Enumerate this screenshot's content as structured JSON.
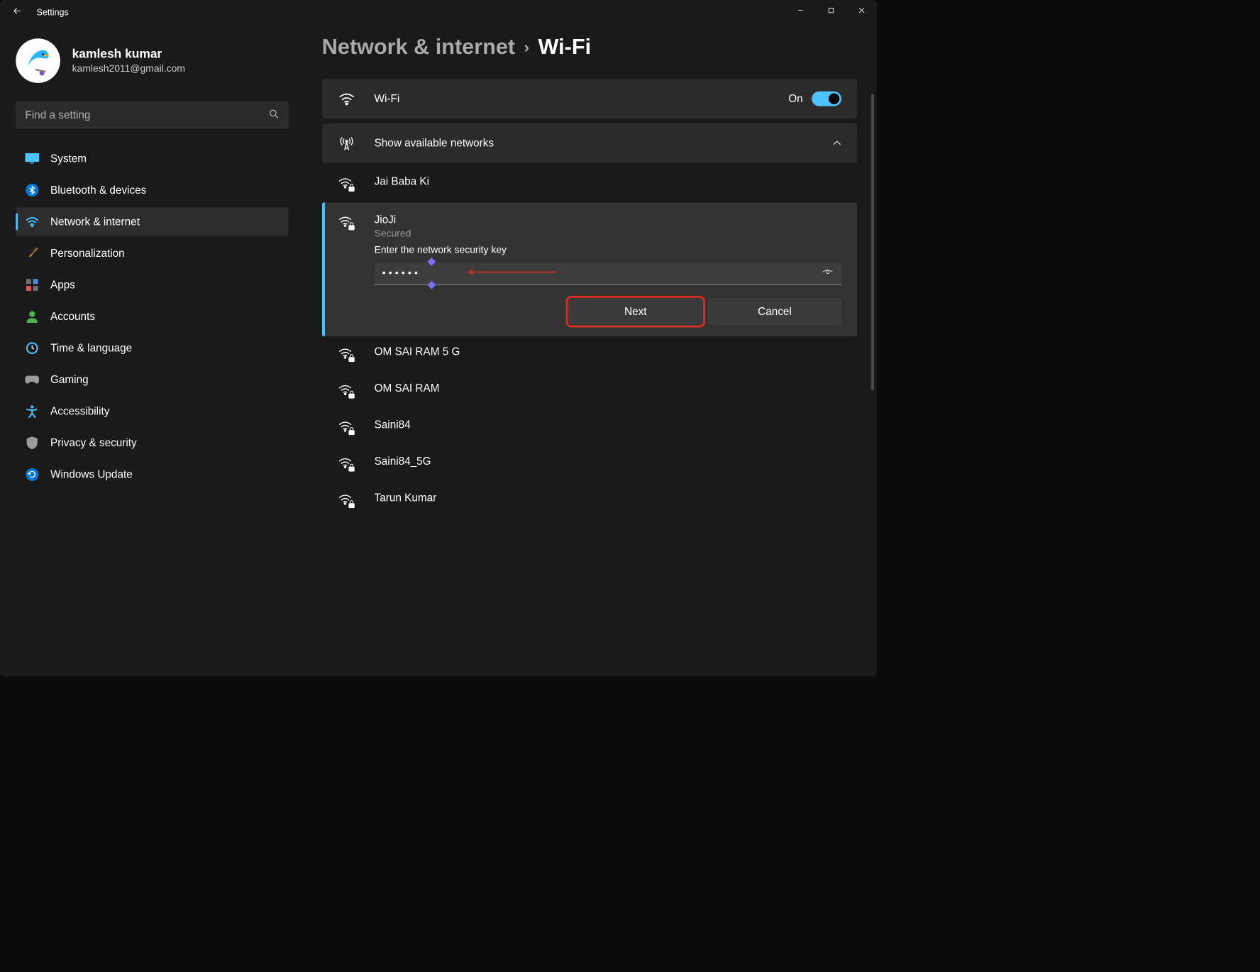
{
  "app": {
    "title": "Settings"
  },
  "user": {
    "name": "kamlesh kumar",
    "email": "kamlesh2011@gmail.com"
  },
  "search": {
    "placeholder": "Find a setting"
  },
  "sidebar": {
    "items": [
      {
        "label": "System",
        "icon": "system-icon",
        "color": "#4cc2ff"
      },
      {
        "label": "Bluetooth & devices",
        "icon": "bluetooth-icon",
        "color": "#0078d4"
      },
      {
        "label": "Network & internet",
        "icon": "wifi-icon",
        "color": "#4cc2ff",
        "active": true
      },
      {
        "label": "Personalization",
        "icon": "brush-icon",
        "color": "#e8a33d"
      },
      {
        "label": "Apps",
        "icon": "apps-icon",
        "color": "#9c9c9c"
      },
      {
        "label": "Accounts",
        "icon": "person-icon",
        "color": "#4caf50"
      },
      {
        "label": "Time & language",
        "icon": "clock-icon",
        "color": "#4cc2ff"
      },
      {
        "label": "Gaming",
        "icon": "gamepad-icon",
        "color": "#9c9c9c"
      },
      {
        "label": "Accessibility",
        "icon": "accessibility-icon",
        "color": "#4cc2ff"
      },
      {
        "label": "Privacy & security",
        "icon": "shield-icon",
        "color": "#9c9c9c"
      },
      {
        "label": "Windows Update",
        "icon": "update-icon",
        "color": "#0078d4"
      }
    ]
  },
  "breadcrumb": {
    "parent": "Network & internet",
    "current": "Wi-Fi"
  },
  "wifi": {
    "label": "Wi-Fi",
    "state": "On",
    "show_networks_label": "Show available networks",
    "networks": [
      {
        "name": "Jai Baba Ki"
      },
      {
        "name": "JioJi",
        "status": "Secured",
        "expanded": true
      },
      {
        "name": "OM SAI RAM 5 G"
      },
      {
        "name": "OM SAI RAM"
      },
      {
        "name": "Saini84"
      },
      {
        "name": "Saini84_5G"
      },
      {
        "name": "Tarun Kumar"
      }
    ],
    "prompt": "Enter the network security key",
    "password_value": "••••••",
    "next_label": "Next",
    "cancel_label": "Cancel"
  }
}
